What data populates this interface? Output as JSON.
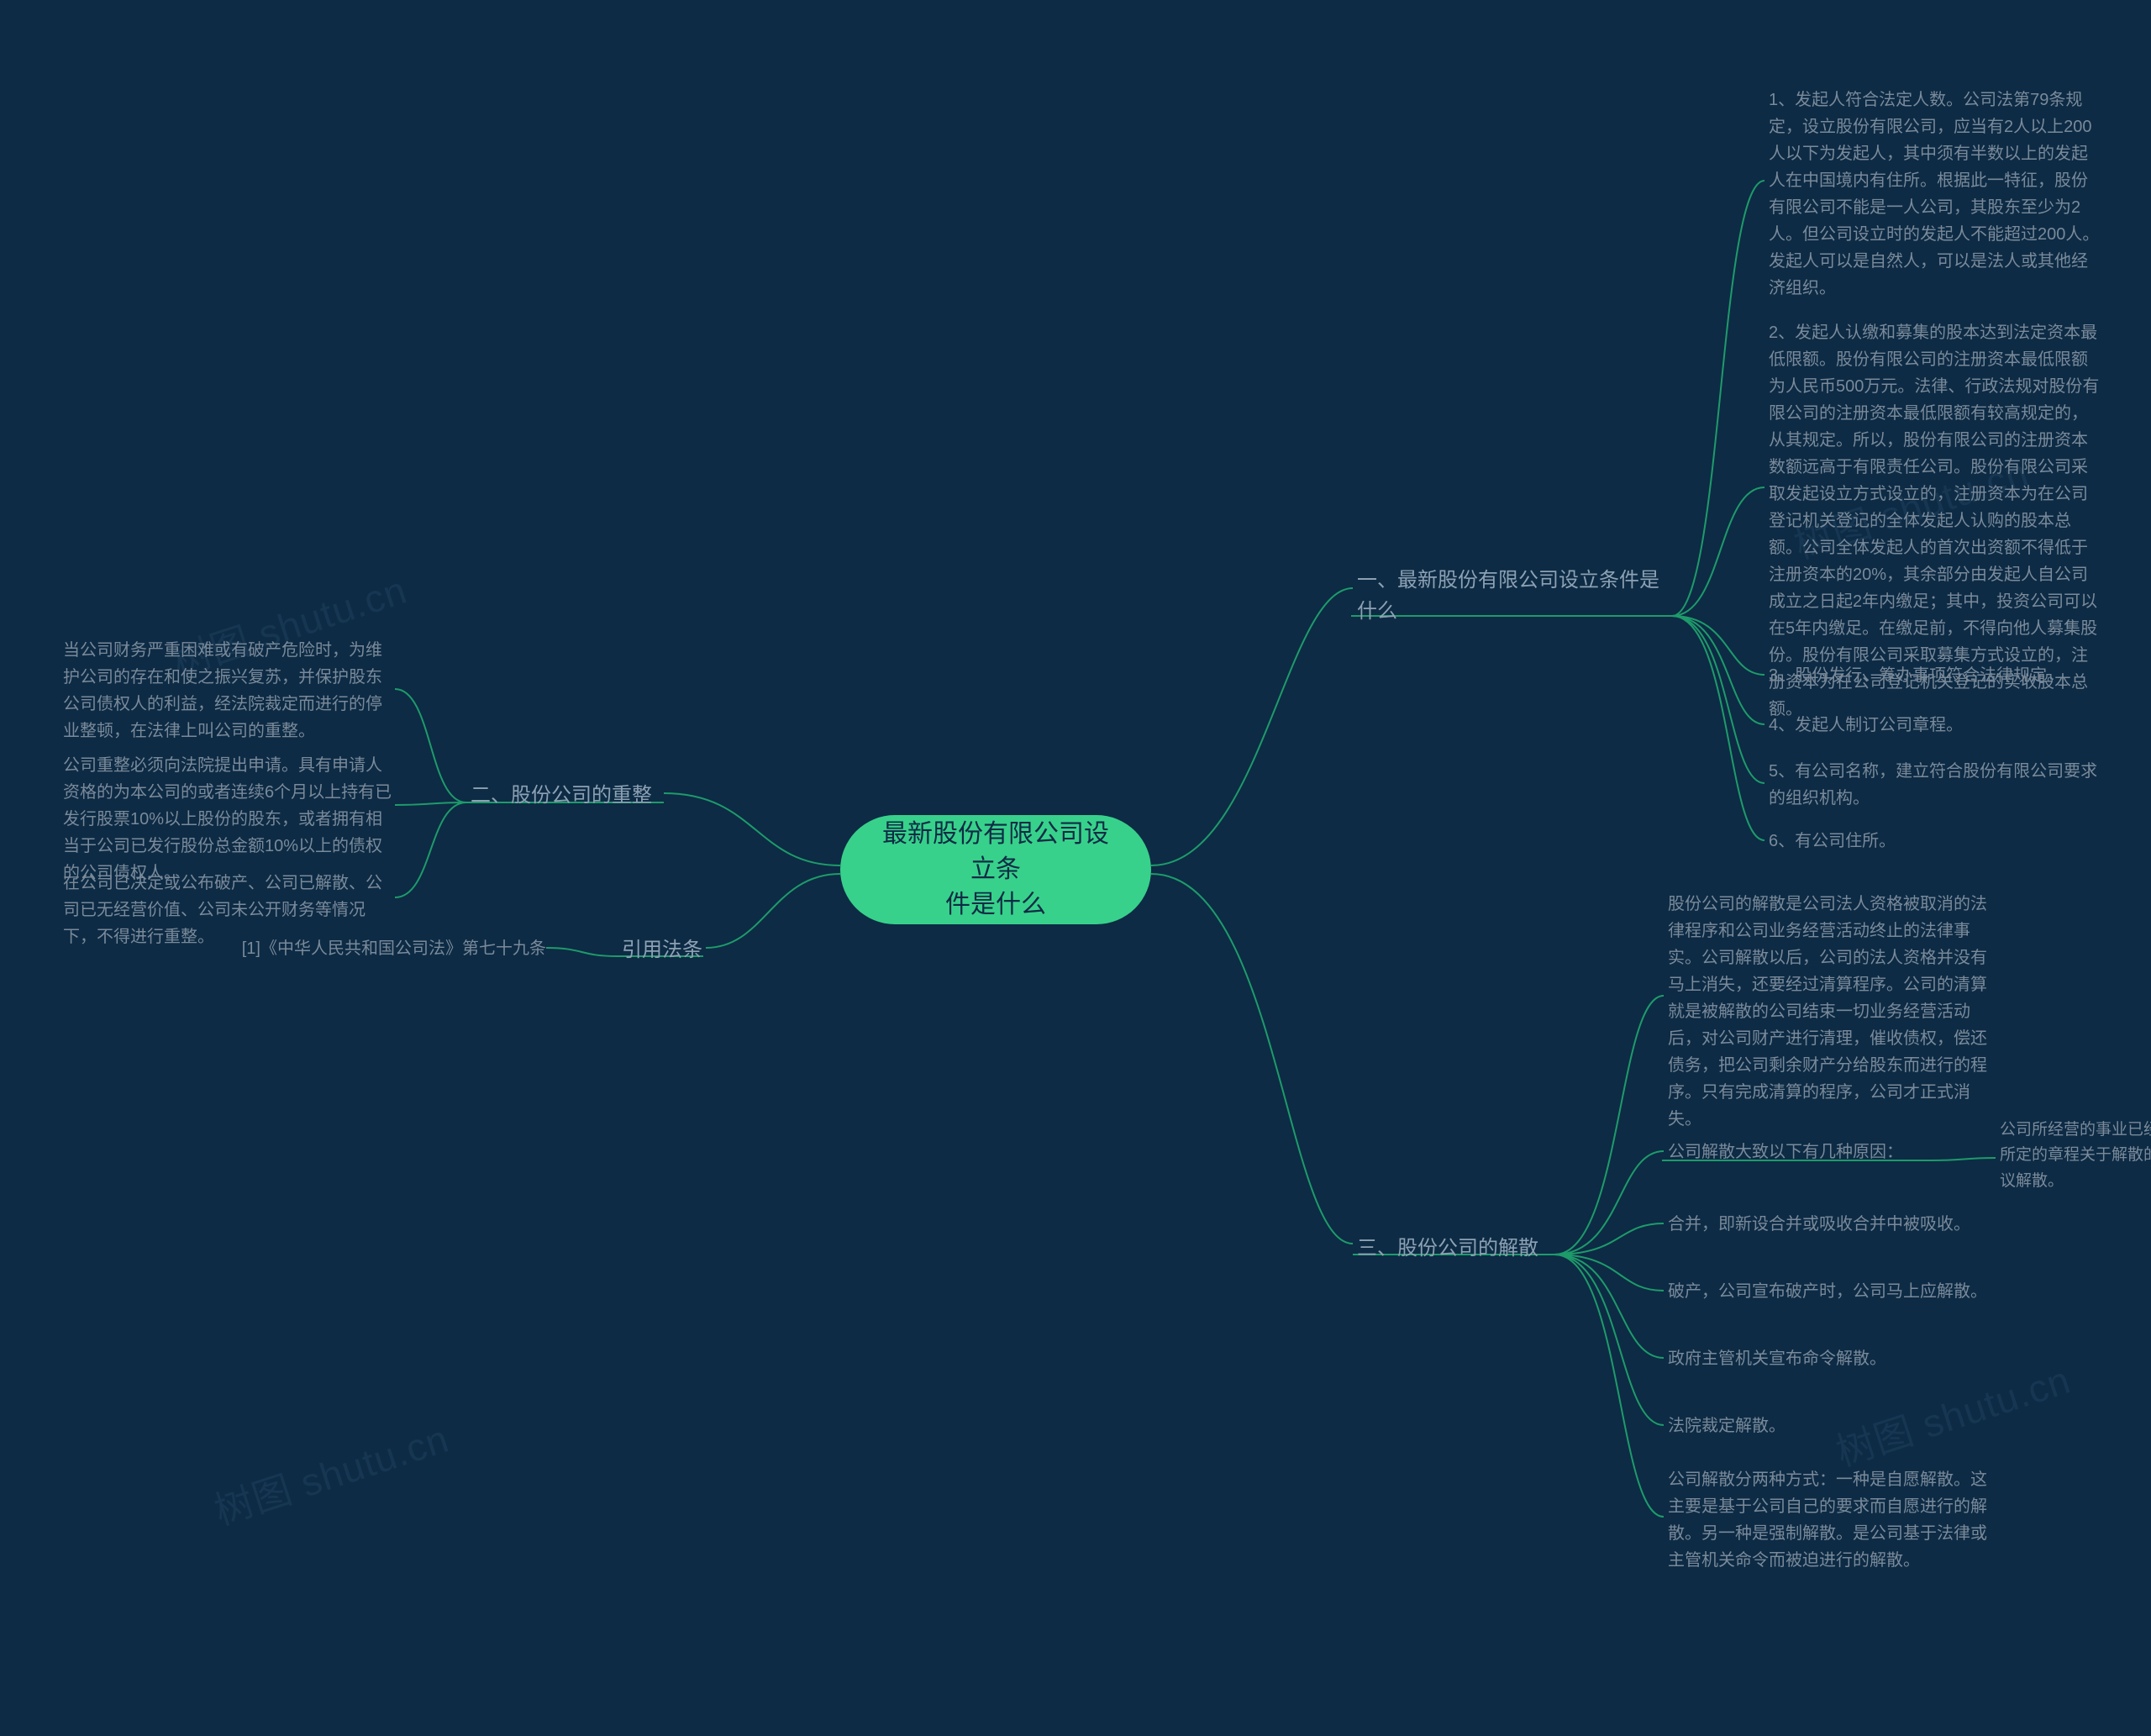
{
  "root": "最新股份有限公司设立条\n件是什么",
  "branch1": {
    "label": "一、最新股份有限公司设立条件是\n什么",
    "leaves": [
      "1、发起人符合法定人数。公司法第79条规定，设立股份有限公司，应当有2人以上200人以下为发起人，其中须有半数以上的发起人在中国境内有住所。根据此一特征，股份有限公司不能是一人公司，其股东至少为2人。但公司设立时的发起人不能超过200人。发起人可以是自然人，可以是法人或其他经济组织。",
      "2、发起人认缴和募集的股本达到法定资本最低限额。股份有限公司的注册资本最低限额为人民币500万元。法律、行政法规对股份有限公司的注册资本最低限额有较高规定的，从其规定。所以，股份有限公司的注册资本数额远高于有限责任公司。股份有限公司采取发起设立方式设立的，注册资本为在公司登记机关登记的全体发起人认购的股本总额。公司全体发起人的首次出资额不得低于注册资本的20%，其余部分由发起人自公司成立之日起2年内缴足；其中，投资公司可以在5年内缴足。在缴足前，不得向他人募集股份。股份有限公司采取募集方式设立的，注册资本为在公司登记机关登记的实收股本总额。",
      "3、股份发行、筹办事项符合法律规定。",
      "4、发起人制订公司章程。",
      "5、有公司名称，建立符合股份有限公司要求的组织机构。",
      "6、有公司住所。"
    ]
  },
  "branch2": {
    "label": "二、股份公司的重整",
    "leaves": [
      "当公司财务严重困难或有破产危险时，为维护公司的存在和使之振兴复苏，并保护股东公司债权人的利益，经法院裁定而进行的停业整顿，在法律上叫公司的重整。",
      "公司重整必须向法院提出申请。具有申请人资格的为本公司的或者连续6个月以上持有已发行股票10%以上股份的股东，或者拥有相当于公司已发行股份总金额10%以上的债权的公司债权人。",
      "在公司已决定或公布破产、公司已解散、公司已无经营价值、公司未公开财务等情况下，不得进行重整。"
    ]
  },
  "branch3": {
    "label": "引用法条",
    "leaves": [
      "[1]《中华人民共和国公司法》第七十九条"
    ]
  },
  "branch4": {
    "label": "三、股份公司的解散",
    "leaves": [
      "股份公司的解散是公司法人资格被取消的法律程序和公司业务经营活动终止的法律事实。公司解散以后，公司的法人资格并没有马上消失，还要经过清算程序。公司的清算就是被解散的公司结束一切业务经营活动后，对公司财产进行清理，催收债权，偿还债务，把公司剩余财产分给股东而进行的程序。只有完成清算的程序，公司才正式消失。",
      "公司解散大致以下有几种原因：",
      "合并，即新设合并或吸收合并中被吸收。",
      "破产，公司宣布破产时，公司马上应解散。",
      "政府主管机关宣布命令解散。",
      "法院裁定解散。",
      "公司解散分两种方式：一种是自愿解散。这主要是基于公司自己的要求而自愿进行的解散。另一种是强制解散。是公司基于法律或主管机关命令而被迫进行的解散。"
    ],
    "sub": "公司所经营的事业已经完成或不能完成，公司所定的章程关于解散的事由发生，股东大会决议解散。"
  },
  "watermarks": [
    "树图 shutu.cn",
    "树图 shutu.cn",
    "树图 shutu.cn",
    "树图 shutu.cn"
  ]
}
